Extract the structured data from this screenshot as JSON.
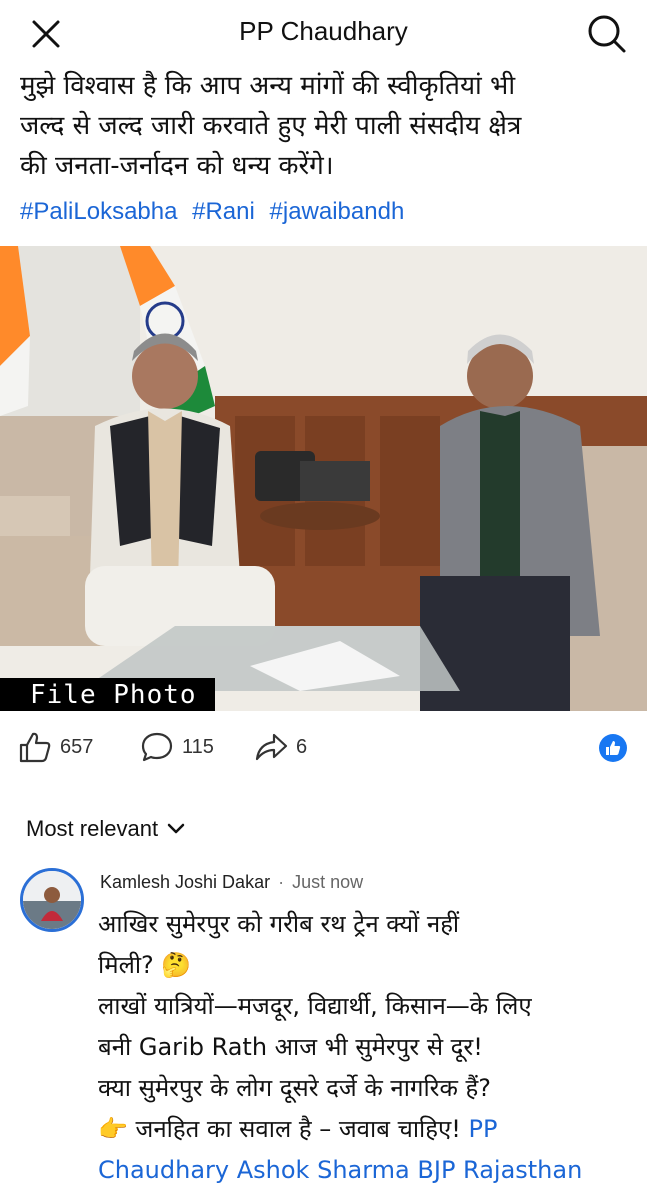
{
  "header": {
    "title": "PP Chaudhary",
    "close_icon": "close-icon",
    "search_icon": "search-icon"
  },
  "post": {
    "text_lines": [
      "मुझे विश्वास है कि आप अन्य मांगों की स्वीकृतियां भी",
      "जल्द से जल्द जारी करवाते हुए मेरी पाली संसदीय क्षेत्र",
      "की जनता-जर्नादन को धन्य करेंगे।"
    ],
    "hashtags": [
      "#PaliLoksabha",
      "#Rani",
      "#jawaibandh"
    ],
    "photo_caption": "File Photo"
  },
  "reactions": {
    "likes": "657",
    "comments": "115",
    "shares": "6"
  },
  "comments_section": {
    "sort_label": "Most relevant"
  },
  "comment": {
    "author": "Kamlesh Joshi Dakar",
    "separator": "·",
    "time": "Just now",
    "lines": [
      "आखिर सुमेरपुर को गरीब रथ ट्रेन क्यों नहीं",
      "मिली? 🤔",
      "लाखों यात्रियों—मजदूर, विद्यार्थी, किसान—के लिए",
      "बनी Garib Rath आज भी सुमेरपुर से दूर!",
      "क्या सुमेरपुर के लोग दूसरे दर्जे के नागरिक हैं?",
      "👉 जनहित का सवाल है – जवाब चाहिए!"
    ],
    "mention_1": "PP",
    "mention_2": "Chaudhary Ashok Sharma BJP Rajasthan"
  },
  "colors": {
    "link": "#1b66d6",
    "like_badge": "#1877f2"
  }
}
